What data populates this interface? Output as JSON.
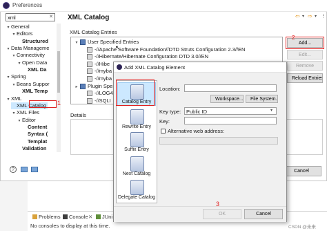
{
  "window": {
    "title": "Preferences",
    "filter_value": "xml"
  },
  "tree": [
    {
      "label": "General",
      "level": 0,
      "twisty": "▾",
      "bold": false
    },
    {
      "label": "Editors",
      "level": 1,
      "twisty": "▾",
      "bold": false
    },
    {
      "label": "Structured",
      "level": 2,
      "twisty": "",
      "bold": true
    },
    {
      "label": "Data Manageme",
      "level": 0,
      "twisty": "▾",
      "bold": false
    },
    {
      "label": "Connectivity",
      "level": 1,
      "twisty": "▾",
      "bold": false
    },
    {
      "label": "Open Data",
      "level": 2,
      "twisty": "▾",
      "bold": false
    },
    {
      "label": "XML Da",
      "level": 3,
      "twisty": "",
      "bold": true
    },
    {
      "label": "Spring",
      "level": 0,
      "twisty": "▾",
      "bold": false
    },
    {
      "label": "Beans Suppor",
      "level": 1,
      "twisty": "▾",
      "bold": false
    },
    {
      "label": "XML Temp",
      "level": 2,
      "twisty": "",
      "bold": true
    },
    {
      "label": "XML",
      "level": 0,
      "twisty": "▾",
      "bold": false
    },
    {
      "label": "XML Catalog",
      "level": 1,
      "twisty": "",
      "bold": false,
      "selected": true
    },
    {
      "label": "XML Files",
      "level": 1,
      "twisty": "▾",
      "bold": false
    },
    {
      "label": "Editor",
      "level": 2,
      "twisty": "▾",
      "bold": false
    },
    {
      "label": "Content",
      "level": 3,
      "twisty": "",
      "bold": true
    },
    {
      "label": "Syntax (",
      "level": 3,
      "twisty": "",
      "bold": true
    },
    {
      "label": "Templat",
      "level": 3,
      "twisty": "",
      "bold": true
    },
    {
      "label": "Validation",
      "level": 2,
      "twisty": "",
      "bold": true
    }
  ],
  "main": {
    "page_title": "XML Catalog",
    "entries_label": "XML Catalog Entries",
    "entries": [
      {
        "label": "User Specified Entries",
        "level": 0,
        "twisty": "▾"
      },
      {
        "label": "-//Apache Software Foundation//DTD Struts Configuration 2.3//EN",
        "level": 1,
        "twisty": ""
      },
      {
        "label": "-//Hibernate/Hibernate Configuration DTD 3.0//EN",
        "level": 1,
        "twisty": ""
      },
      {
        "label": "-//Hibe",
        "level": 1,
        "twisty": ""
      },
      {
        "label": "-//myba",
        "level": 1,
        "twisty": ""
      },
      {
        "label": "-//myba",
        "level": 1,
        "twisty": ""
      },
      {
        "label": "Plugin Spe",
        "level": 0,
        "twisty": "▸"
      },
      {
        "label": "-//LOG4",
        "level": 1,
        "twisty": ""
      },
      {
        "label": "-//SQLI",
        "level": 1,
        "twisty": ""
      }
    ],
    "buttons": {
      "add": "Add...",
      "edit": "Edit...",
      "remove": "Remove",
      "reload": "Reload Entries"
    },
    "details_label": "Details",
    "cancel": "Cancel"
  },
  "bottom_panel": {
    "tabs": [
      "Problems",
      "Console",
      "JUni"
    ],
    "message": "No consoles to display at this time."
  },
  "dialog": {
    "title": "Add XML Catalog Element",
    "sidebar": [
      "Catalog Entry",
      "Rewrite Entry",
      "Suffix Entry",
      "Next Catalog",
      "Delegate Catalog"
    ],
    "location_label": "Location:",
    "workspace_button": "Workspace...",
    "filesystem_button": "File System...",
    "keytype_label": "Key type:",
    "keytype_value": "Public ID",
    "key_label": "Key:",
    "alt_web_label": "Alternative web address:",
    "ok": "OK",
    "cancel": "Cancel"
  },
  "annotations": [
    "1",
    "2",
    "3"
  ],
  "watermark": "CSDN @未来",
  "colors": {
    "selection": "#cce8ff",
    "annotation": "#e02020",
    "link_blue": "#0b5cad"
  }
}
